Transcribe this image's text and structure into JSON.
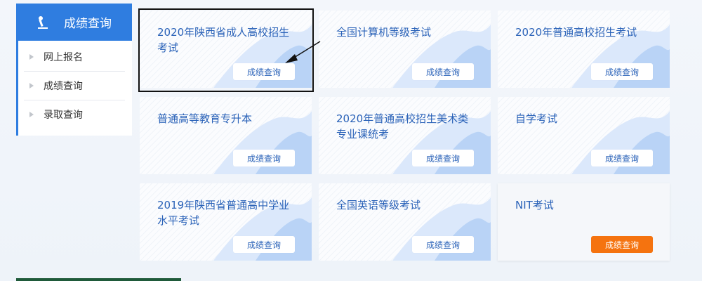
{
  "sidebar": {
    "title": "成绩查询",
    "items": [
      {
        "label": "网上报名"
      },
      {
        "label": "成绩查询"
      },
      {
        "label": "录取查询"
      }
    ]
  },
  "cards": [
    {
      "title": "2020年陕西省成人高校招生考试",
      "button": "成绩查询"
    },
    {
      "title": "全国计算机等级考试",
      "button": "成绩查询"
    },
    {
      "title": "2020年普通高校招生考试",
      "button": "成绩查询"
    },
    {
      "title": "普通高等教育专升本",
      "button": "成绩查询"
    },
    {
      "title": "2020年普通高校招生美术类专业课统考",
      "button": "成绩查询"
    },
    {
      "title": "自学考试",
      "button": "成绩查询"
    },
    {
      "title": "2019年陕西省普通高中学业水平考试",
      "button": "成绩查询"
    },
    {
      "title": "全国英语等级考试",
      "button": "成绩查询"
    },
    {
      "title": "NIT考试",
      "button": "成绩查询"
    }
  ],
  "colors": {
    "accent": "#2f7de0",
    "title_text": "#2a62b8",
    "hot_button": "#f5730f"
  }
}
